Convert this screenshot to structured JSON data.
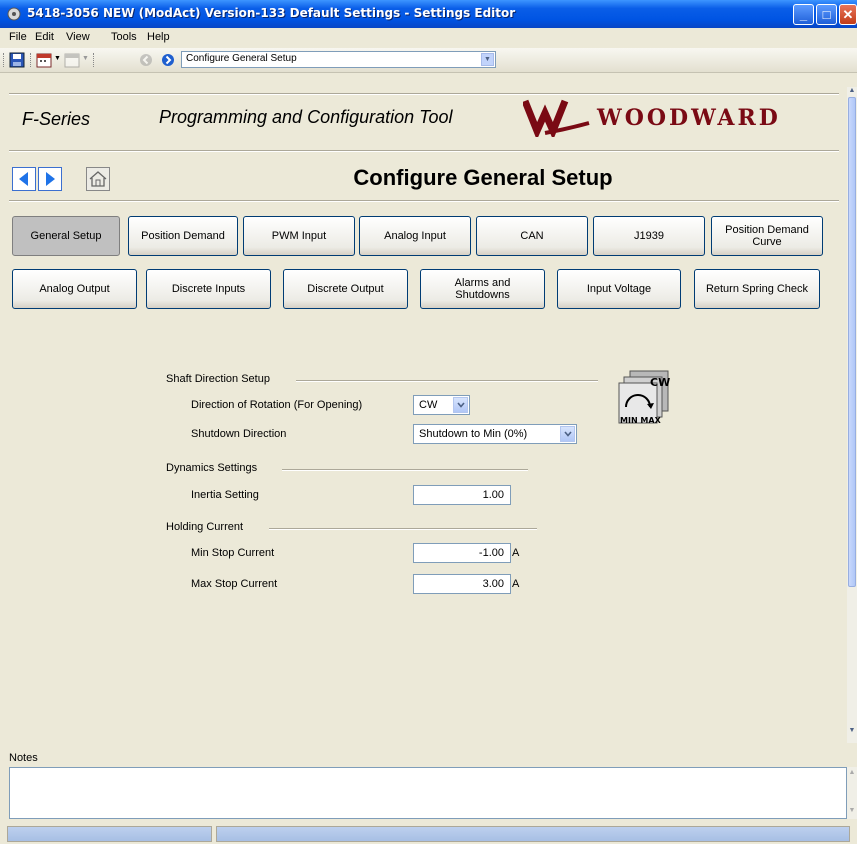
{
  "window": {
    "title": "5418-3056 NEW (ModAct) Version-133 Default Settings - Settings Editor",
    "min": "_",
    "max": "□",
    "close": "✕"
  },
  "menu": [
    "File",
    "Edit",
    "View",
    "Tools",
    "Help"
  ],
  "toolbar": {
    "page_selector_value": "Configure General Setup"
  },
  "brand": {
    "series": "F-Series",
    "product": "Programming and Configuration Tool",
    "company": "WOODWARD"
  },
  "page_title": "Configure  General Setup",
  "tabs_row1": [
    "General Setup",
    "Position Demand",
    "PWM Input",
    "Analog Input",
    "CAN",
    "J1939",
    "Position Demand\nCurve"
  ],
  "tabs_row2": [
    "Analog Output",
    "Discrete Inputs",
    "Discrete Output",
    "Alarms and\nShutdowns",
    "Input Voltage",
    "Return Spring Check"
  ],
  "active_tab": "General Setup",
  "shaft": {
    "group": "Shaft Direction Setup",
    "rotation_label": "Direction of Rotation (For Opening)",
    "rotation_value": "CW",
    "shutdown_label": "Shutdown Direction",
    "shutdown_value": "Shutdown to Min (0%)",
    "graphic_cw": "CW",
    "graphic_minmax": "MIN MAX"
  },
  "dynamics": {
    "group": "Dynamics Settings",
    "inertia_label": "Inertia Setting",
    "inertia_value": "1.00"
  },
  "holding": {
    "group": "Holding Current",
    "min_label": "Min Stop Current",
    "min_value": "-1.00",
    "max_label": "Max Stop Current",
    "max_value": "3.00",
    "unit": "A"
  },
  "notes": {
    "label": "Notes",
    "value": ""
  },
  "colors": {
    "title_blue": "#0054e3",
    "woodward_red": "#7a0a14",
    "window_bg": "#ece9d8"
  }
}
